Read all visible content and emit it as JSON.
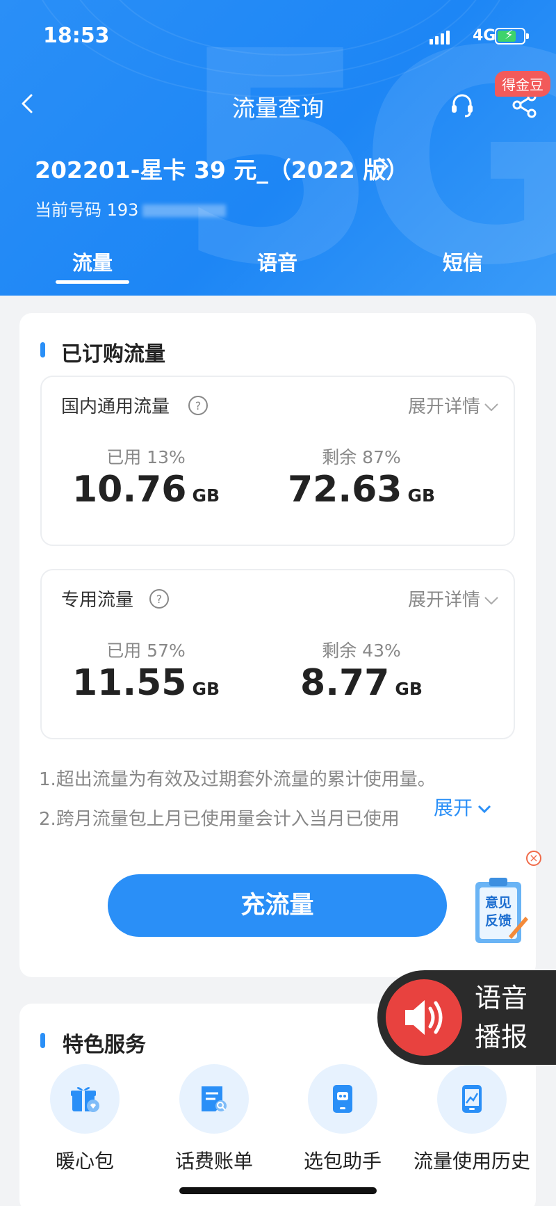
{
  "status": {
    "time": "18:53",
    "network": "4G"
  },
  "nav": {
    "title": "流量查询",
    "badge": "得金豆"
  },
  "plan": {
    "name": "202201-星卡 39 元_（2022 版）",
    "phone_label": "当前号码 193"
  },
  "tabs": [
    "流量",
    "语音",
    "短信"
  ],
  "subscribed": {
    "title": "已订购流量",
    "expand_label": "展开详情",
    "domestic": {
      "title": "国内通用流量",
      "used_label": "已用 13%",
      "used_value": "10.76",
      "remain_label": "剩余 87%",
      "remain_value": "72.63",
      "unit": "GB"
    },
    "dedicated": {
      "title": "专用流量",
      "used_label": "已用 57%",
      "used_value": "11.55",
      "remain_label": "剩余 43%",
      "remain_value": "8.77",
      "unit": "GB"
    },
    "notes": [
      "1.超出流量为有效及过期套外流量的累计使用量。",
      "2.跨月流量包上月已使用量会计入当月已使用"
    ],
    "notes_expand": "展开",
    "recharge_label": "充流量"
  },
  "feedback_label": "意见反馈",
  "voice": {
    "line1": "语音",
    "line2": "播报"
  },
  "services": {
    "title": "特色服务",
    "items": [
      "暖心包",
      "话费账单",
      "选包助手",
      "流量使用历史"
    ]
  }
}
